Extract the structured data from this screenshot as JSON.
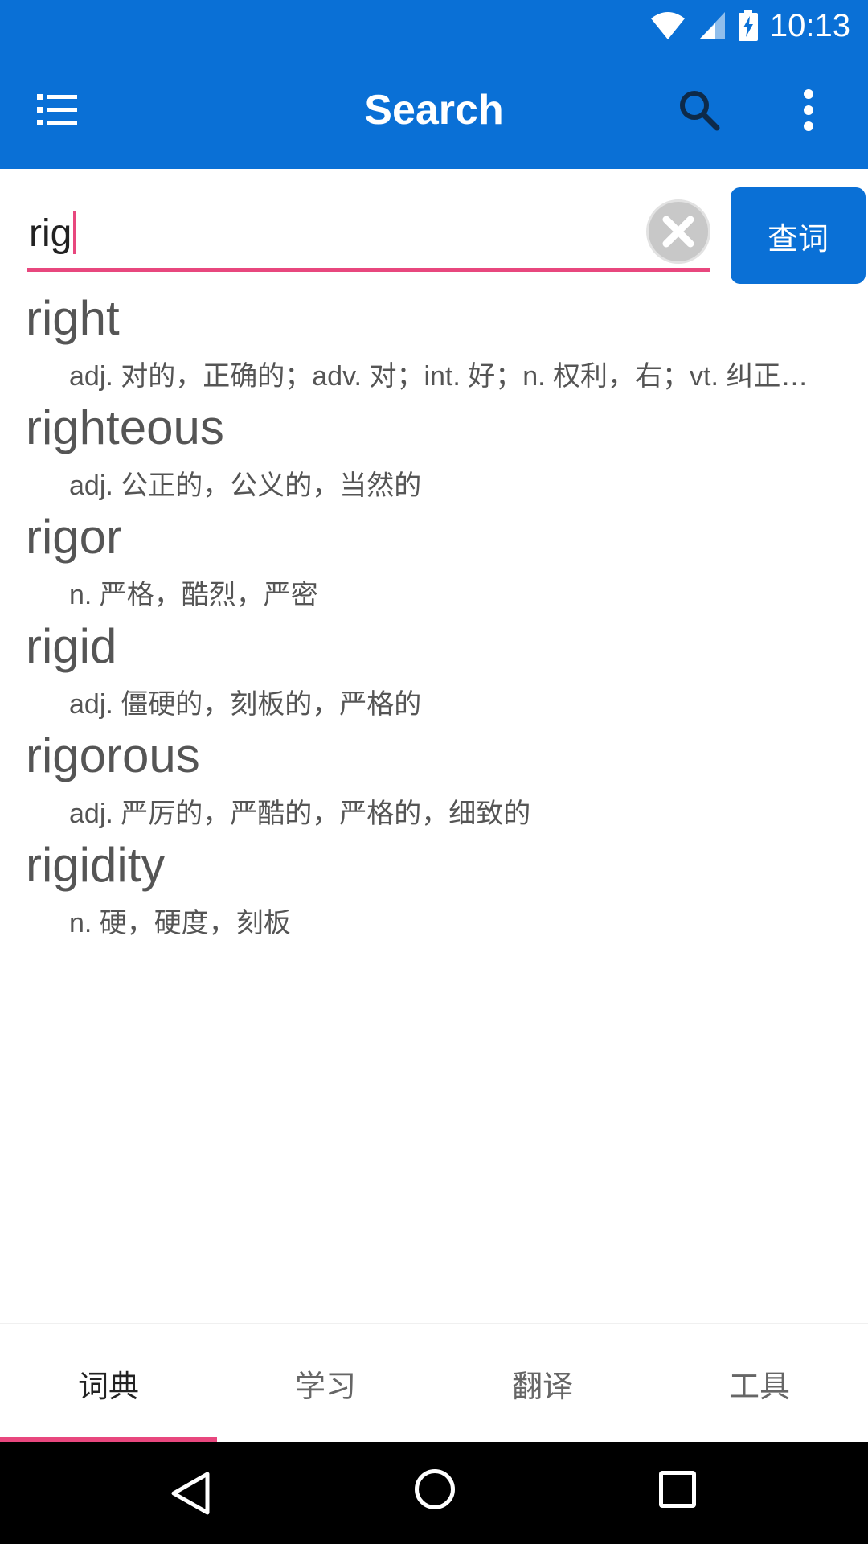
{
  "status_bar": {
    "time": "10:13",
    "icons": [
      "wifi-icon",
      "signal-icon",
      "battery-charging-icon"
    ]
  },
  "app_bar": {
    "title": "Search",
    "icons": [
      "menu-list-icon",
      "search-icon",
      "more-vert-icon"
    ]
  },
  "search": {
    "value": "rig",
    "clear_icon": "clear-circle-icon",
    "query_button_label": "查词",
    "accent_color": "#e8477e"
  },
  "results": [
    {
      "word": "right",
      "meaning": "adj. 对的，正确的；adv. 对；int. 好；n. 权利，右；vt. 纠正…"
    },
    {
      "word": "righteous",
      "meaning": "adj. 公正的，公义的，当然的"
    },
    {
      "word": "rigor",
      "meaning": "n. 严格，酷烈，严密"
    },
    {
      "word": "rigid",
      "meaning": "adj. 僵硬的，刻板的，严格的"
    },
    {
      "word": "rigorous",
      "meaning": "adj. 严厉的，严酷的，严格的，细致的"
    },
    {
      "word": "rigidity",
      "meaning": "n. 硬，硬度，刻板"
    }
  ],
  "tabs": [
    {
      "label": "词典",
      "active": true
    },
    {
      "label": "学习",
      "active": false
    },
    {
      "label": "翻译",
      "active": false
    },
    {
      "label": "工具",
      "active": false
    }
  ],
  "nav_bar": {
    "icons": [
      "back-icon",
      "home-icon",
      "recents-icon"
    ]
  },
  "colors": {
    "primary": "#0a70d6",
    "accent": "#e8477e",
    "text": "#555555"
  }
}
